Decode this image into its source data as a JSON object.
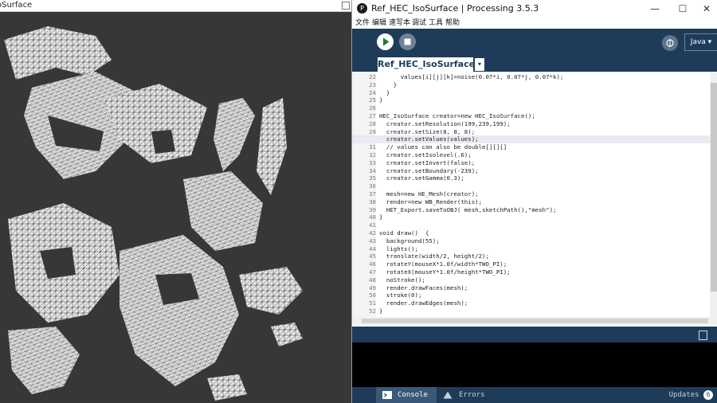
{
  "sketch_window": {
    "title": "oSurface"
  },
  "ide": {
    "title": "Ref_HEC_IsoSurface | Processing 3.5.3",
    "app_icon": "processing-logo-icon",
    "window_controls": {
      "minimize": "—",
      "maximize": "☐",
      "close": "✕"
    },
    "menu": [
      "文件",
      "编辑",
      "速写本",
      "调试",
      "工具",
      "帮助"
    ],
    "toolbar": {
      "mode": "Java ▾",
      "run_icon": "play-icon",
      "stop_icon": "stop-icon",
      "debug_icon": "debugger-icon"
    },
    "tab": {
      "label": "Ref_HEC_IsoSurface",
      "menu_glyph": "▾"
    },
    "editor": {
      "highlighted_line": 30,
      "lines": [
        {
          "n": "22",
          "t": "      values[i][j][k]=noise(0.07*i, 0.07*j, 0.07*k);"
        },
        {
          "n": "23",
          "t": "    }"
        },
        {
          "n": "24",
          "t": "  }"
        },
        {
          "n": "25",
          "t": "}"
        },
        {
          "n": "26",
          "t": ""
        },
        {
          "n": "27",
          "t": "HEC_IsoSurface creator=new HEC_IsoSurface();"
        },
        {
          "n": "28",
          "t": "  creator.setResolution(199,239,199);"
        },
        {
          "n": "29",
          "t": "  creator.setSize(8, 8, 8);"
        },
        {
          "n": "30",
          "t": "  creator.setValues(values);"
        },
        {
          "n": "31",
          "t": "  // values can also be double[][][]"
        },
        {
          "n": "32",
          "t": "  creator.setIsolevel(.6);"
        },
        {
          "n": "33",
          "t": "  creator.setInvert(false);"
        },
        {
          "n": "34",
          "t": "  creator.setBoundary(-239);"
        },
        {
          "n": "35",
          "t": "  creator.setGamma(0.3);"
        },
        {
          "n": "36",
          "t": ""
        },
        {
          "n": "37",
          "t": "  mesh=new HE_Mesh(creator);"
        },
        {
          "n": "38",
          "t": "  render=new WB_Render(this);"
        },
        {
          "n": "39",
          "t": "  HET_Export.saveToOBJ( mesh,sketchPath(),\"mesh\");"
        },
        {
          "n": "40",
          "t": "}"
        },
        {
          "n": "41",
          "t": ""
        },
        {
          "n": "42",
          "t": "void draw()  {"
        },
        {
          "n": "43",
          "t": "  background(55);"
        },
        {
          "n": "44",
          "t": "  lights();"
        },
        {
          "n": "45",
          "t": "  translate(width/2, height/2);"
        },
        {
          "n": "46",
          "t": "  rotateY(mouseX*1.0f/width*TWO_PI);"
        },
        {
          "n": "47",
          "t": "  rotateX(mouseY*1.0f/height*TWO_PI);"
        },
        {
          "n": "48",
          "t": "  noStroke();"
        },
        {
          "n": "49",
          "t": "  render.drawFaces(mesh);"
        },
        {
          "n": "50",
          "t": "  stroke(0);"
        },
        {
          "n": "51",
          "t": "  render.drawEdges(mesh);"
        },
        {
          "n": "52",
          "t": "}"
        }
      ]
    },
    "footer": {
      "console_label": "Console",
      "errors_label": "Errors",
      "updates_label": "Updates",
      "updates_count": "6"
    }
  }
}
